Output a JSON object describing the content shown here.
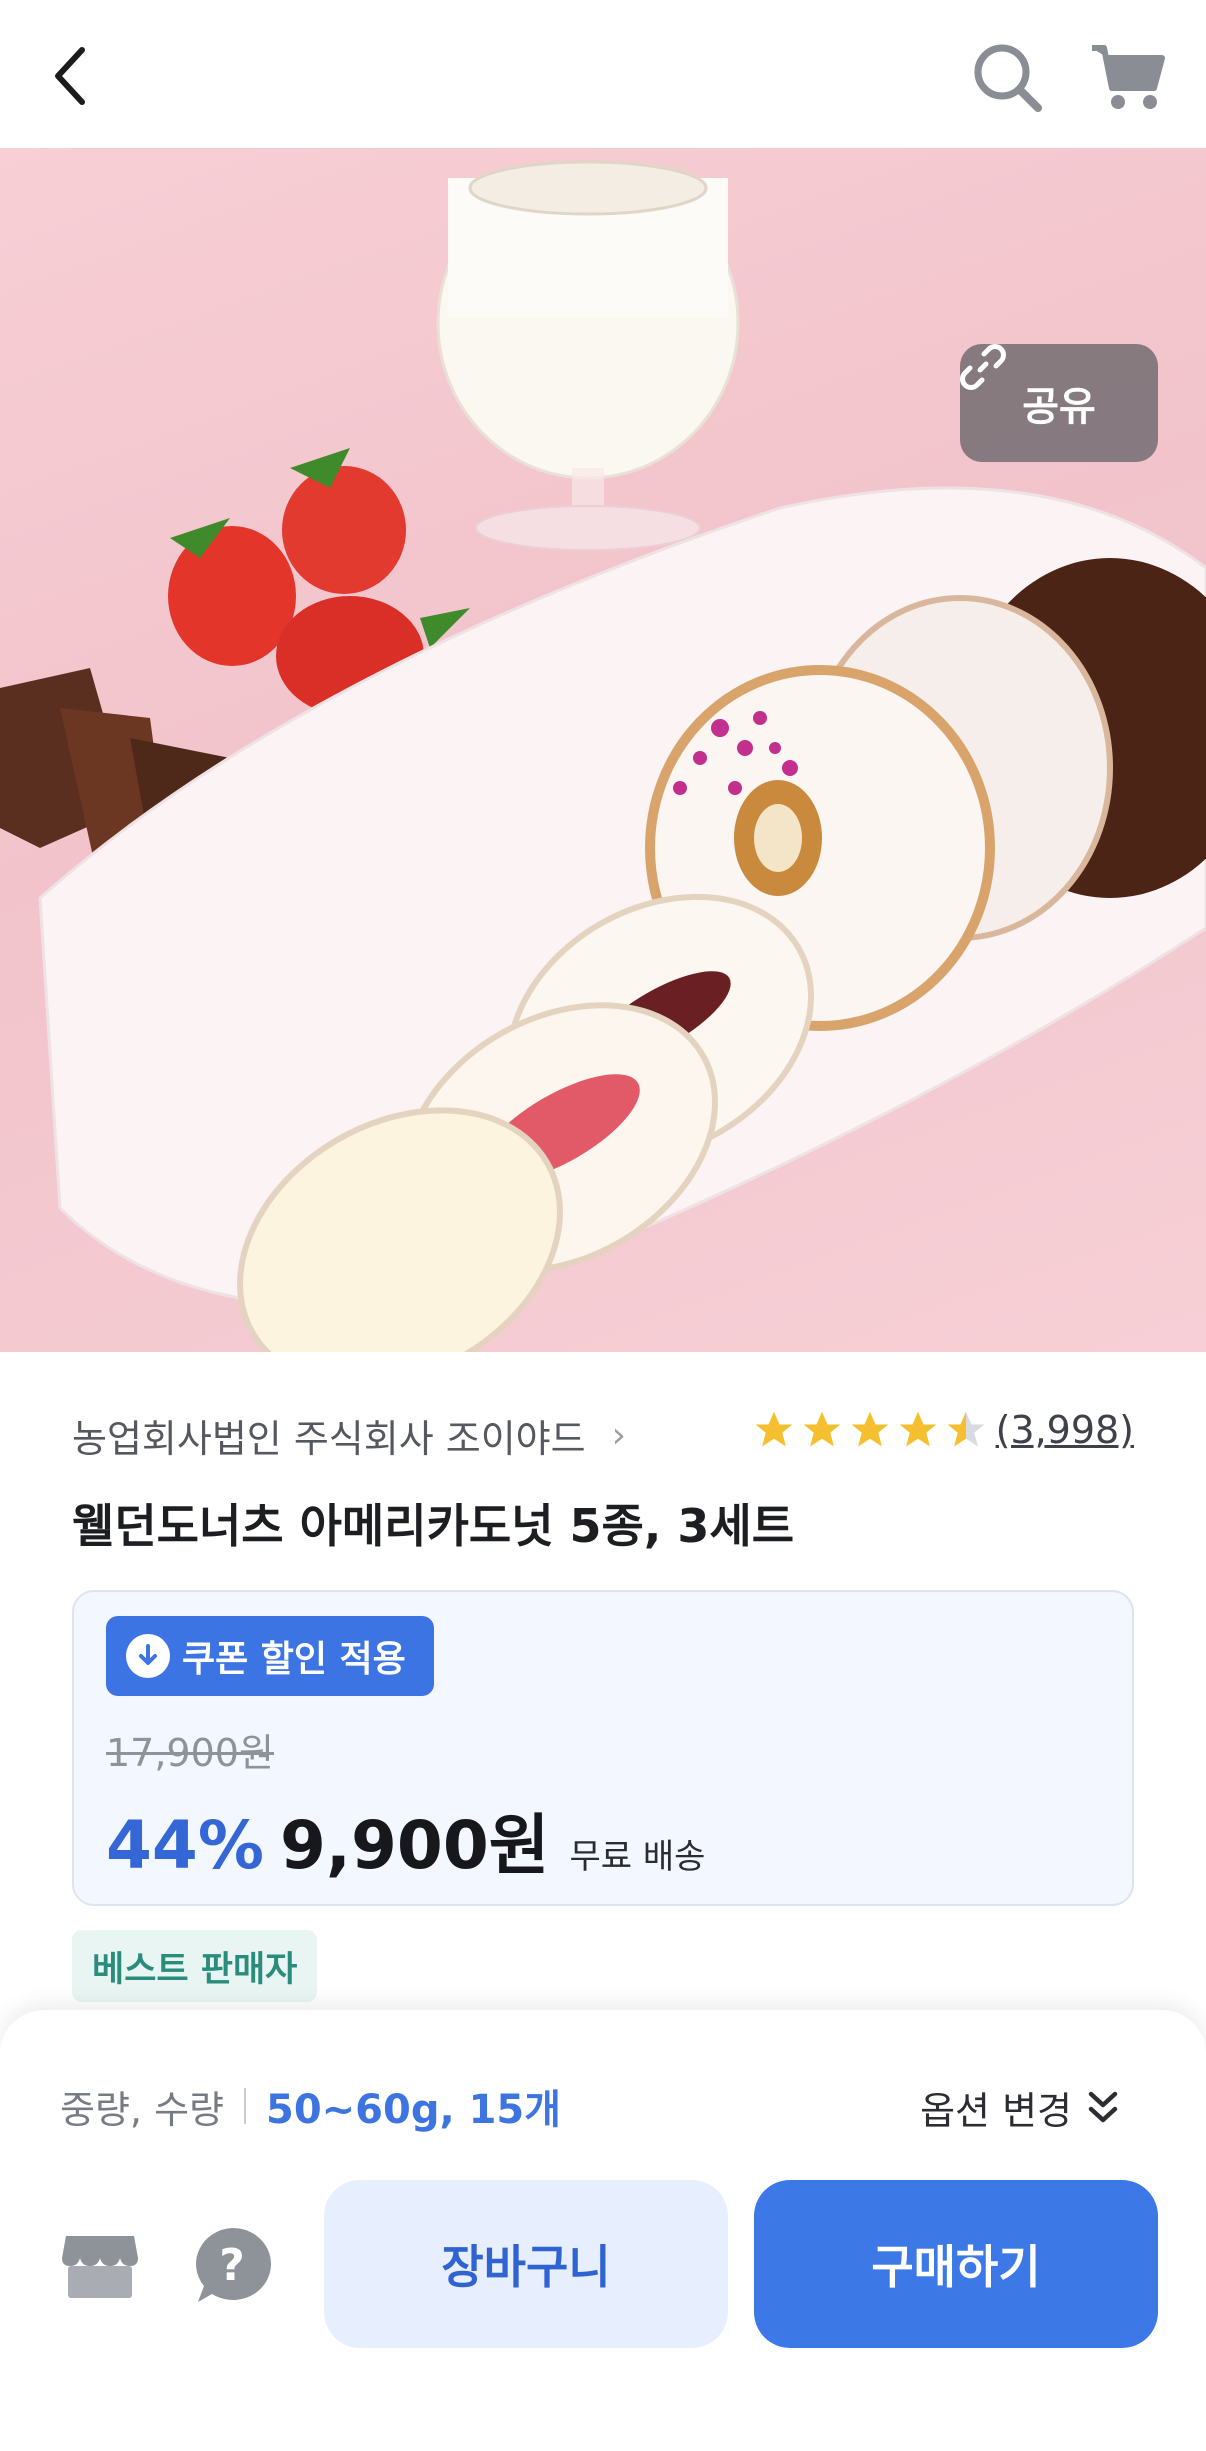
{
  "nav": {
    "back_icon": "chevron-left-icon",
    "search_icon": "search-icon",
    "cart_icon": "cart-icon"
  },
  "hero": {
    "share_label": "공유",
    "share_icon": "link-icon"
  },
  "product": {
    "seller": "농업회사법인 주식회사 조이야드",
    "rating": 4.5,
    "review_count": "(3,998)",
    "title": "웰던도너츠 아메리카도넛 5종, 3세트"
  },
  "price": {
    "coupon_label": "쿠폰 할인 적용",
    "original": "17,900원",
    "discount": "44%",
    "final": "9,900원",
    "shipping": "무료 배송"
  },
  "badge": {
    "best_seller": "베스트 판매자"
  },
  "sheet": {
    "option_label": "중량, 수량",
    "option_value": "50~60g, 15개",
    "option_change": "옵션 변경",
    "cart_button": "장바구니",
    "buy_button": "구매하기"
  },
  "colors": {
    "accent": "#3c78e6",
    "coupon": "#3c74e4",
    "discount": "#3566d6",
    "star": "#f6bf2f",
    "best_badge_text": "#2a8d7b"
  }
}
